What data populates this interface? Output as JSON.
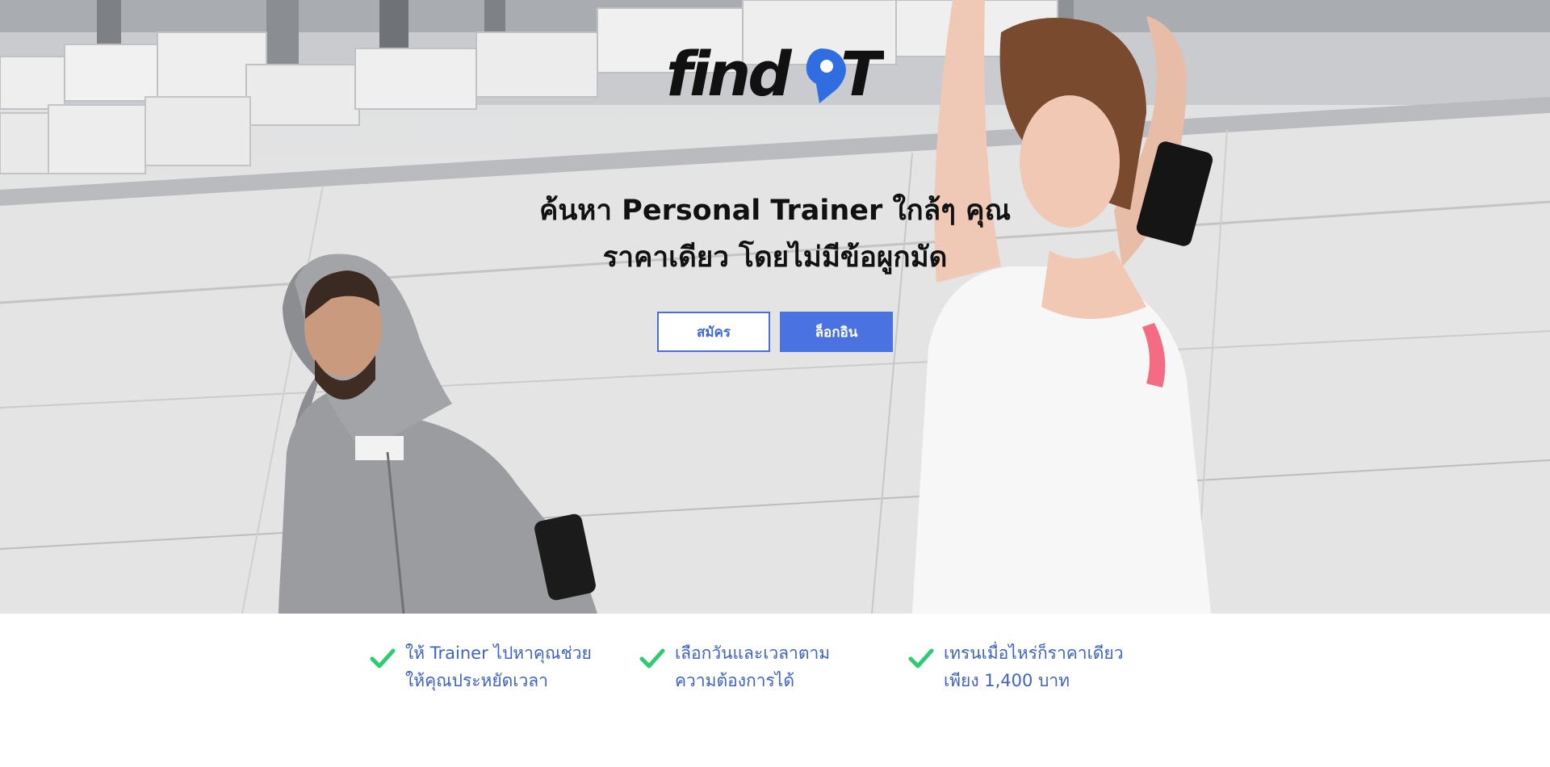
{
  "brand": {
    "logo_text": "findPT",
    "accent_color": "#2f6de0"
  },
  "hero": {
    "headline_line1": "ค้นหา Personal Trainer ใกล้ๆ คุณ",
    "headline_line2": "ราคาเดียว โดยไม่มีข้อผูกมัด",
    "register_label": "สมัคร",
    "login_label": "ล็อกอิน"
  },
  "features": [
    {
      "icon": "check-icon",
      "line1": "ให้ Trainer ไปหาคุณช่วย",
      "line2": "ให้คุณประหยัดเวลา"
    },
    {
      "icon": "check-icon",
      "line1": "เลือกวันและเวลาตาม",
      "line2": "ความต้องการได้"
    },
    {
      "icon": "check-icon",
      "line1": "เทรนเมื่อไหร่ก็ราคาเดียว",
      "line2": "เพียง 1,400 บาท"
    }
  ],
  "colors": {
    "primary_button": "#4a72e0",
    "feature_text": "#3d63c9",
    "check": "#2ecc71"
  }
}
